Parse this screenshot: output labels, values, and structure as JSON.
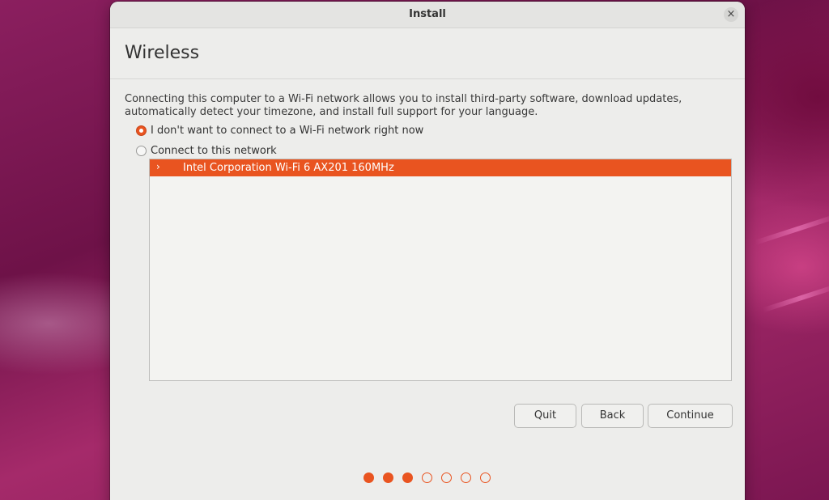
{
  "window": {
    "title": "Install",
    "close_icon": "close-icon",
    "close_glyph": "×"
  },
  "page": {
    "title": "Wireless",
    "description": "Connecting this computer to a Wi-Fi network allows you to install third-party software, download updates, automatically detect your timezone, and install full support for your language."
  },
  "options": [
    {
      "label": "I don't want to connect to a Wi-Fi network right now",
      "selected": true
    },
    {
      "label": "Connect to this network",
      "selected": false
    }
  ],
  "networks": [
    {
      "name": "Intel Corporation Wi-Fi 6 AX201 160MHz",
      "expand_glyph": "›",
      "icon": "chevron-right-icon",
      "selected": true
    }
  ],
  "buttons": {
    "quit": "Quit",
    "back": "Back",
    "continue": "Continue"
  },
  "progress": {
    "total_steps": 7,
    "completed_steps": 3
  },
  "colors": {
    "accent": "#e95420",
    "window_bg": "#ededeb",
    "desktop_bg": "#7a1450"
  }
}
